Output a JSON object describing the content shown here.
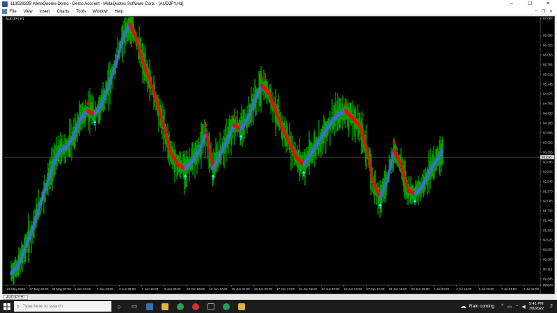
{
  "window": {
    "title": "113528335: MetaQuotes-Demo - Demo Account - MetaQuotes Software Corp. - [AUDJPY,H1]",
    "minimize": "–",
    "maximize": "☐",
    "close": "✕"
  },
  "menu": {
    "items": [
      "File",
      "View",
      "Insert",
      "Charts",
      "Tools",
      "Window",
      "Help"
    ],
    "mdi_minimize": "–",
    "mdi_restore": "❐",
    "mdi_close": "✕"
  },
  "chart": {
    "label": "AUDJPY,H1",
    "current_price_label": "93.218",
    "colors": {
      "background": "#000000",
      "price": "#00a000",
      "trend_up": "#4169e1",
      "trend_down": "#ff0000",
      "grid": "#3a3a3a",
      "buy_arrow": "#00ffff",
      "sell_arrow": "#ff0000",
      "price_line": "#7a7a7a"
    }
  },
  "chart_data": {
    "type": "line",
    "symbol": "AUDJPY",
    "timeframe": "H1",
    "ylim": [
      89.67,
      97.0
    ],
    "y_ticks": [
      97.065,
      96.595,
      96.325,
      96.055,
      95.785,
      95.515,
      95.245,
      94.975,
      94.705,
      94.435,
      94.165,
      93.895,
      93.625,
      93.355,
      93.085,
      92.815,
      92.545,
      92.275,
      92.005,
      91.735,
      91.465,
      91.195,
      90.925,
      90.655,
      90.385,
      90.115,
      89.845,
      89.67
    ],
    "x_ticks": [
      "26 May 2022",
      "27 May 22:00",
      "31 May 07:00",
      "1 Jun 15:00",
      "2 Jun 23:00",
      "6 Jun 08:00",
      "7 Jun 16:00",
      "9 Jun 00:00",
      "10 Jun 08:00",
      "13 Jun 17:00",
      "15 Jun 01:00",
      "16 Jun 09:00",
      "17 Jun 17:00",
      "21 Jun 02:00",
      "22 Jun 10:00",
      "23 Jun 18:00",
      "27 Jun 03:00",
      "28 Jun 11:00",
      "29 Jun 19:00",
      "1 Jul 03:00",
      "4 Jul 12:00",
      "5 Jul 20:00",
      "7 Jul 04:00",
      "8 Jul 12:00"
    ],
    "series": [
      {
        "x": [
          0,
          10,
          20,
          30,
          40,
          50,
          60,
          70,
          80,
          90,
          100,
          110,
          120,
          130,
          140,
          150,
          160,
          170,
          180,
          190,
          200,
          210,
          220,
          230,
          240,
          250,
          260,
          270,
          280,
          290,
          300,
          310,
          320,
          330,
          340,
          350,
          360,
          370,
          380,
          390,
          400,
          410,
          420,
          430,
          440,
          450,
          460,
          470,
          480,
          490,
          500,
          510,
          520,
          530,
          540,
          550,
          560,
          570,
          580,
          590,
          600,
          610,
          620
        ],
        "values": [
          90.0,
          90.2,
          90.7,
          91.2,
          91.8,
          92.4,
          93.0,
          93.4,
          93.5,
          93.8,
          94.3,
          94.5,
          94.4,
          94.7,
          95.2,
          95.8,
          96.5,
          96.9,
          96.5,
          95.8,
          95.3,
          94.7,
          94.0,
          93.3,
          93.0,
          92.9,
          93.1,
          93.4,
          93.9,
          92.9,
          93.3,
          93.7,
          94.1,
          94.0,
          94.3,
          94.8,
          95.2,
          95.0,
          94.5,
          94.0,
          93.6,
          93.2,
          93.0,
          93.3,
          93.6,
          93.9,
          94.2,
          94.4,
          94.5,
          94.3,
          94.1,
          93.5,
          92.5,
          92.1,
          92.6,
          93.4,
          93.0,
          92.3,
          92.2,
          92.4,
          92.8,
          93.1,
          93.4
        ]
      }
    ],
    "grid": true,
    "last_price": 93.218
  },
  "tabs": {
    "items": [
      "AUDJPY,H1"
    ]
  },
  "taskbar": {
    "search_placeholder": "Type here to search",
    "weather_text": "Rain coming",
    "time": "5:41 PM",
    "date": "7/8/2022",
    "notification_badge": "2"
  }
}
